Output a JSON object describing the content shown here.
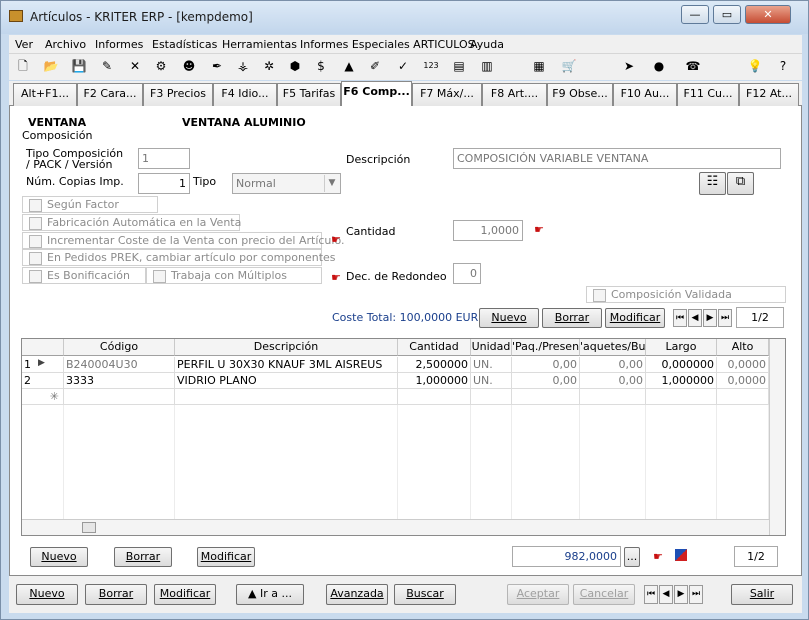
{
  "window": {
    "title": "Artículos - KRITER ERP - [kempdemo]",
    "min_label": "—",
    "max_label": "▭",
    "close_label": "✕"
  },
  "menu": [
    "Ver",
    "Archivo",
    "Informes",
    "Estadísticas",
    "Herramientas",
    "Informes Especiales ARTICULOS",
    "Ayuda"
  ],
  "toolbar_icons": [
    "new-document-icon",
    "open-folder-icon",
    "save-icon",
    "edit-icon",
    "delete-icon",
    "tools-icon",
    "person-icon",
    "pen-icon",
    "structure-icon",
    "snowflake-icon",
    "box-icon",
    "money-icon",
    "stamp-icon",
    "brush-icon",
    "check-icon",
    "numbers-icon",
    "print-icon",
    "chart-icon",
    "calculator-icon",
    "cart-icon",
    "tag-icon",
    "money-bag-icon",
    "phone-icon",
    "bulb-icon",
    "help-icon"
  ],
  "toolbar_glyphs": [
    "🗋",
    "📂",
    "💾",
    "✎",
    "✕",
    "⚙",
    "☻",
    "✒",
    "⚶",
    "✲",
    "⬢",
    "$",
    "▲",
    "✐",
    "✓",
    "123",
    "▤",
    "▥",
    "▦",
    "🛒",
    "➤",
    "●",
    "☎",
    "💡",
    "?"
  ],
  "tabs": [
    "Alt+F1...",
    "F2 Cara...",
    "F3 Precios",
    "F4 Idio...",
    "F5 Tarifas",
    "F6 Comp...",
    "F7 Máx/...",
    "F8 Art....",
    "F9 Obse...",
    "F10 Au...",
    "F11 Cu...",
    "F12 At..."
  ],
  "active_tab": 5,
  "article": {
    "code": "VENTANA",
    "name": "VENTANA ALUMINIO",
    "section": "Composición"
  },
  "form": {
    "tipo_composicion_label": "Tipo Composición / PACK / Versión",
    "tipo_composicion_value": "1",
    "num_copias_label": "Núm. Copias Imp.",
    "num_copias_value": "1",
    "tipo_label": "Tipo",
    "tipo_value": "Normal",
    "descripcion_label": "Descripción",
    "descripcion_value": "COMPOSICIÓN VARIABLE VENTANA",
    "cantidad_label": "Cantidad",
    "cantidad_value": "1,0000",
    "dec_redondeo_label": "Dec. de Redondeo",
    "dec_redondeo_value": "0",
    "composicion_validada": "Composición Validada",
    "coste_total": "Coste Total: 100,0000 EUR",
    "page": "1/2"
  },
  "checks": [
    "Según Factor",
    "Fabricación Automática en la Venta",
    "Incrementar Coste de la Venta con precio del Artículo.",
    "En Pedidos PREK, cambiar artículo por componentes",
    "Es Bonificación",
    "Trabaja con Múltiplos"
  ],
  "top_buttons": {
    "nuevo": "Nuevo",
    "borrar": "Borrar",
    "modificar": "Modificar"
  },
  "grid": {
    "columns": [
      "",
      "Código",
      "Descripción",
      "Cantidad",
      "Unidad",
      "'Paq./Presen",
      "'aquetes/Bult",
      "Largo",
      "Alto"
    ],
    "rows": [
      {
        "n": "1",
        "codigo": "B240004U30",
        "descripcion": "PERFIL U 30X30 KNAUF 3ML AISREUS",
        "cantidad": "2,500000",
        "unidad": "UN.",
        "paq": "0,00",
        "paquetes": "0,00",
        "largo": "0,000000",
        "alto": "0,0000"
      },
      {
        "n": "2",
        "codigo": "3333",
        "descripcion": "VIDRIO PLANO",
        "cantidad": "1,000000",
        "unidad": "UN.",
        "paq": "0,00",
        "paquetes": "0,00",
        "largo": "1,000000",
        "alto": "0,0000"
      }
    ],
    "new_row_marker": "✳"
  },
  "grid_footer": {
    "nuevo": "Nuevo",
    "borrar": "Borrar",
    "modificar": "Modificar",
    "total": "982,0000",
    "ellipsis": "...",
    "page": "1/2"
  },
  "bottom": {
    "nuevo": "Nuevo",
    "borrar": "Borrar",
    "modificar": "Modificar",
    "ira": "▲ Ir a ...",
    "avanzada": "Avanzada",
    "buscar": "Buscar",
    "aceptar": "Aceptar",
    "cancelar": "Cancelar",
    "salir": "Salir"
  },
  "nav_glyphs": [
    "⏮",
    "◀",
    "▶",
    "⏭"
  ]
}
